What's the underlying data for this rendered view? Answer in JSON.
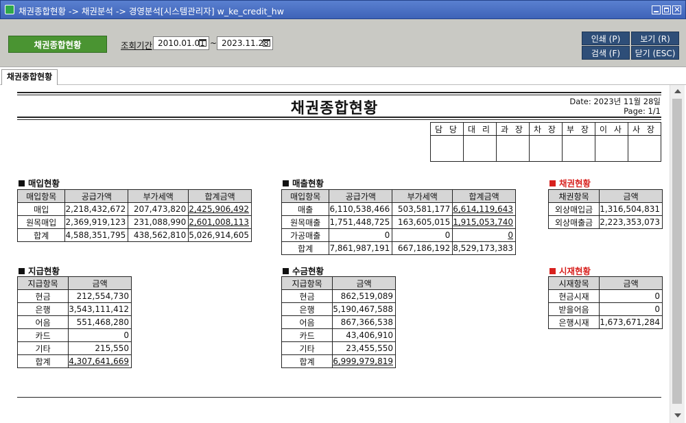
{
  "window": {
    "title": "채권종합현황 -> 채권분석 -> 경영분석[시스템관리자] w_ke_credit_hw"
  },
  "toolbar": {
    "main_button": "채권종합현황",
    "period_label": "조회기간",
    "date_from": "2010.01.01",
    "date_to": "2023.11.28",
    "tilde": "~",
    "print": "인쇄 (P)",
    "view": "보기 (R)",
    "search": "검색 (F)",
    "close": "닫기 (ESC)"
  },
  "tab": {
    "label": "채권종합현황"
  },
  "report": {
    "title": "채권종합현황",
    "date_line": "Date: 2023년 11월 28일",
    "page_line": "Page: 1/1",
    "approval": [
      "담 당",
      "대 리",
      "과 장",
      "차 장",
      "부 장",
      "이 사",
      "사 장"
    ],
    "purchase": {
      "title": "매입현황",
      "headers": [
        "매입항목",
        "공급가액",
        "부가세액",
        "합계금액"
      ],
      "rows": [
        [
          "매입",
          "2,218,432,672",
          "207,473,820",
          "2,425,906,492"
        ],
        [
          "원목매입",
          "2,369,919,123",
          "231,088,990",
          "2,601,008,113"
        ],
        [
          "합계",
          "4,588,351,795",
          "438,562,810",
          "5,026,914,605"
        ]
      ]
    },
    "sales": {
      "title": "매출현황",
      "headers": [
        "매입항목",
        "공급가액",
        "부가세액",
        "합계금액"
      ],
      "rows": [
        [
          "매출",
          "6,110,538,466",
          "503,581,177",
          "6,614,119,643"
        ],
        [
          "원목매출",
          "1,751,448,725",
          "163,605,015",
          "1,915,053,740"
        ],
        [
          "가공매출",
          "0",
          "0",
          "0"
        ],
        [
          "합계",
          "7,861,987,191",
          "667,186,192",
          "8,529,173,383"
        ]
      ]
    },
    "credit": {
      "title": "채권현황",
      "headers": [
        "채권항목",
        "금액"
      ],
      "rows": [
        [
          "외상매입금",
          "1,316,504,831"
        ],
        [
          "외상매출금",
          "2,223,353,073"
        ]
      ]
    },
    "payment": {
      "title": "지급현황",
      "headers": [
        "지급항목",
        "금액"
      ],
      "rows": [
        [
          "현금",
          "212,554,730"
        ],
        [
          "은행",
          "3,543,111,412"
        ],
        [
          "어음",
          "551,468,280"
        ],
        [
          "카드",
          "0"
        ],
        [
          "기타",
          "215,550"
        ],
        [
          "합계",
          "4,307,641,669"
        ]
      ]
    },
    "receipt": {
      "title": "수금현황",
      "headers": [
        "지급항목",
        "금액"
      ],
      "rows": [
        [
          "현금",
          "862,519,089"
        ],
        [
          "은행",
          "5,190,467,588"
        ],
        [
          "어음",
          "867,366,538"
        ],
        [
          "카드",
          "43,406,910"
        ],
        [
          "기타",
          "23,455,550"
        ],
        [
          "합계",
          "6,999,979,819"
        ]
      ]
    },
    "cash": {
      "title": "시재현황",
      "headers": [
        "시재항목",
        "금액"
      ],
      "rows": [
        [
          "현금시재",
          "0"
        ],
        [
          "받을어음",
          "0"
        ],
        [
          "은행시재",
          "1,673,671,284"
        ]
      ]
    }
  },
  "colors": {
    "titlebar": "#4a6fc0",
    "green_button": "#4a9432",
    "navy_button": "#2e4e78",
    "red_section": "#d8211e"
  }
}
